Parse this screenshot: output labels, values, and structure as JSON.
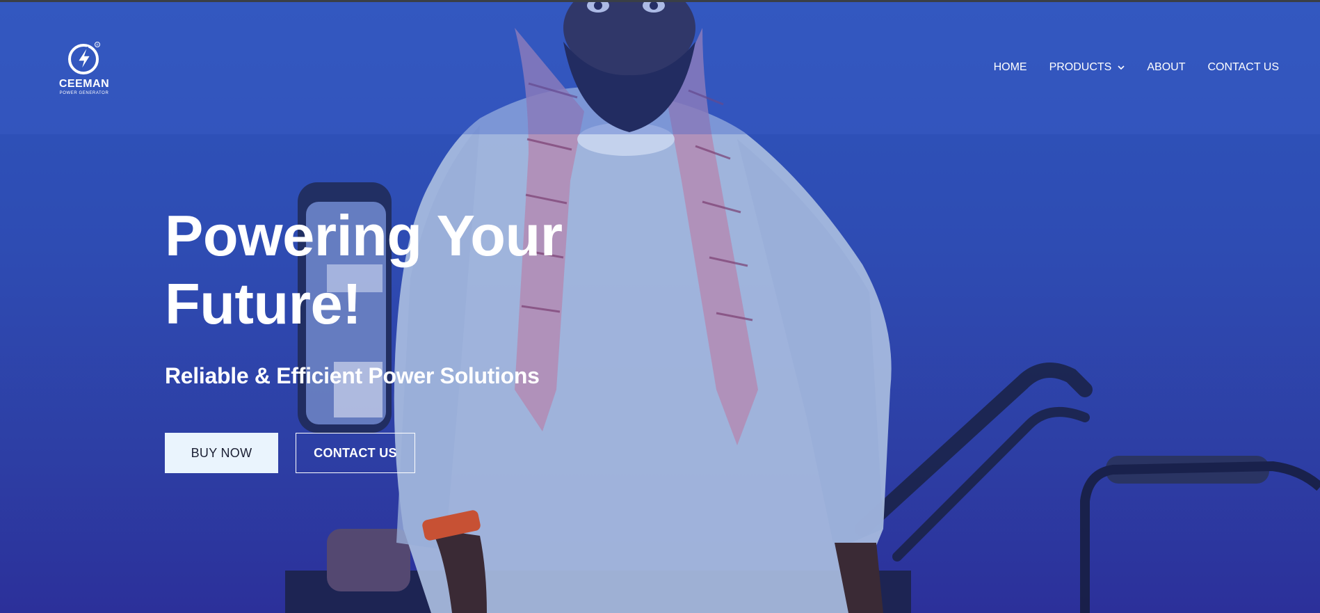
{
  "brand": {
    "name": "CEEMAN",
    "tagline": "POWER GENERATOR",
    "logo_icon": "lightning-bolt-icon",
    "registered_mark": "®"
  },
  "nav": {
    "items": [
      {
        "label": "HOME"
      },
      {
        "label": "PRODUCTS",
        "has_dropdown": true,
        "icon": "chevron-down-icon"
      },
      {
        "label": "ABOUT"
      },
      {
        "label": "CONTACT US"
      }
    ]
  },
  "hero": {
    "title": "Powering Your Future!",
    "subtitle": "Reliable & Efficient Power Solutions",
    "buy_label": "BUY NOW",
    "contact_label": "CONTACT US"
  },
  "colors": {
    "hero_overlay": "#2e4cb3",
    "header_strip": "#3a3f46",
    "buy_button_bg": "#eaf4fd",
    "text": "#ffffff"
  }
}
